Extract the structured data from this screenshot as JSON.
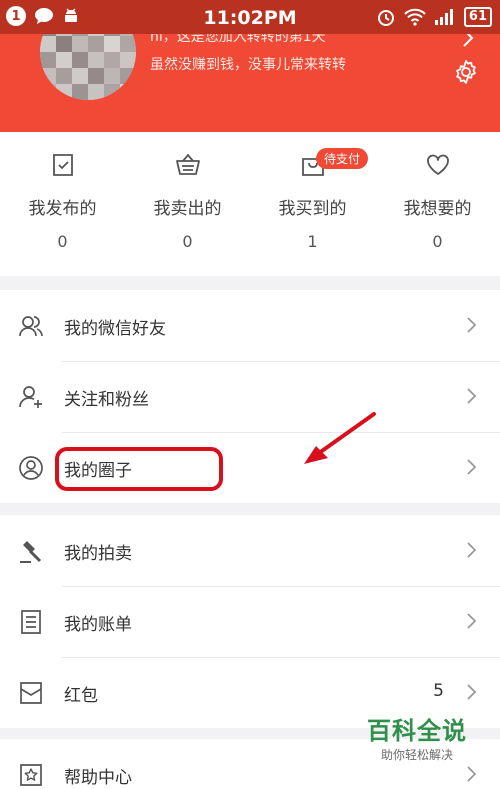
{
  "status_bar": {
    "notification_count": "1",
    "time": "11:02PM",
    "battery": "61"
  },
  "profile": {
    "intro_line1": "hi，这是您加入转转的第1天",
    "intro_line2": "虽然没赚到钱，没事儿常来转转"
  },
  "stats": [
    {
      "label": "我发布的",
      "count": "0",
      "icon": "checklist-icon"
    },
    {
      "label": "我卖出的",
      "count": "0",
      "icon": "basket-icon"
    },
    {
      "label": "我买到的",
      "count": "1",
      "icon": "bag-icon"
    },
    {
      "label": "我想要的",
      "count": "0",
      "icon": "heart-icon"
    }
  ],
  "pending_badge": "待支付",
  "menu_group1": [
    {
      "label": "我的微信好友",
      "icon": "wechat-friends-icon"
    },
    {
      "label": "关注和粉丝",
      "icon": "add-person-icon"
    },
    {
      "label": "我的圈子",
      "icon": "circle-user-icon"
    }
  ],
  "menu_group2": [
    {
      "label": "我的拍卖",
      "icon": "gavel-icon"
    },
    {
      "label": "我的账单",
      "icon": "bill-icon"
    },
    {
      "label": "红包",
      "icon": "red-envelope-icon",
      "value": "5"
    }
  ],
  "menu_group3": [
    {
      "label": "帮助中心",
      "icon": "star-box-icon"
    }
  ],
  "watermark": {
    "title": "百科全说",
    "subtitle": "助你轻松解决"
  },
  "colors": {
    "brand": "#f04a36",
    "annotation": "#d8101d",
    "watermark": "#2f8f4b"
  }
}
